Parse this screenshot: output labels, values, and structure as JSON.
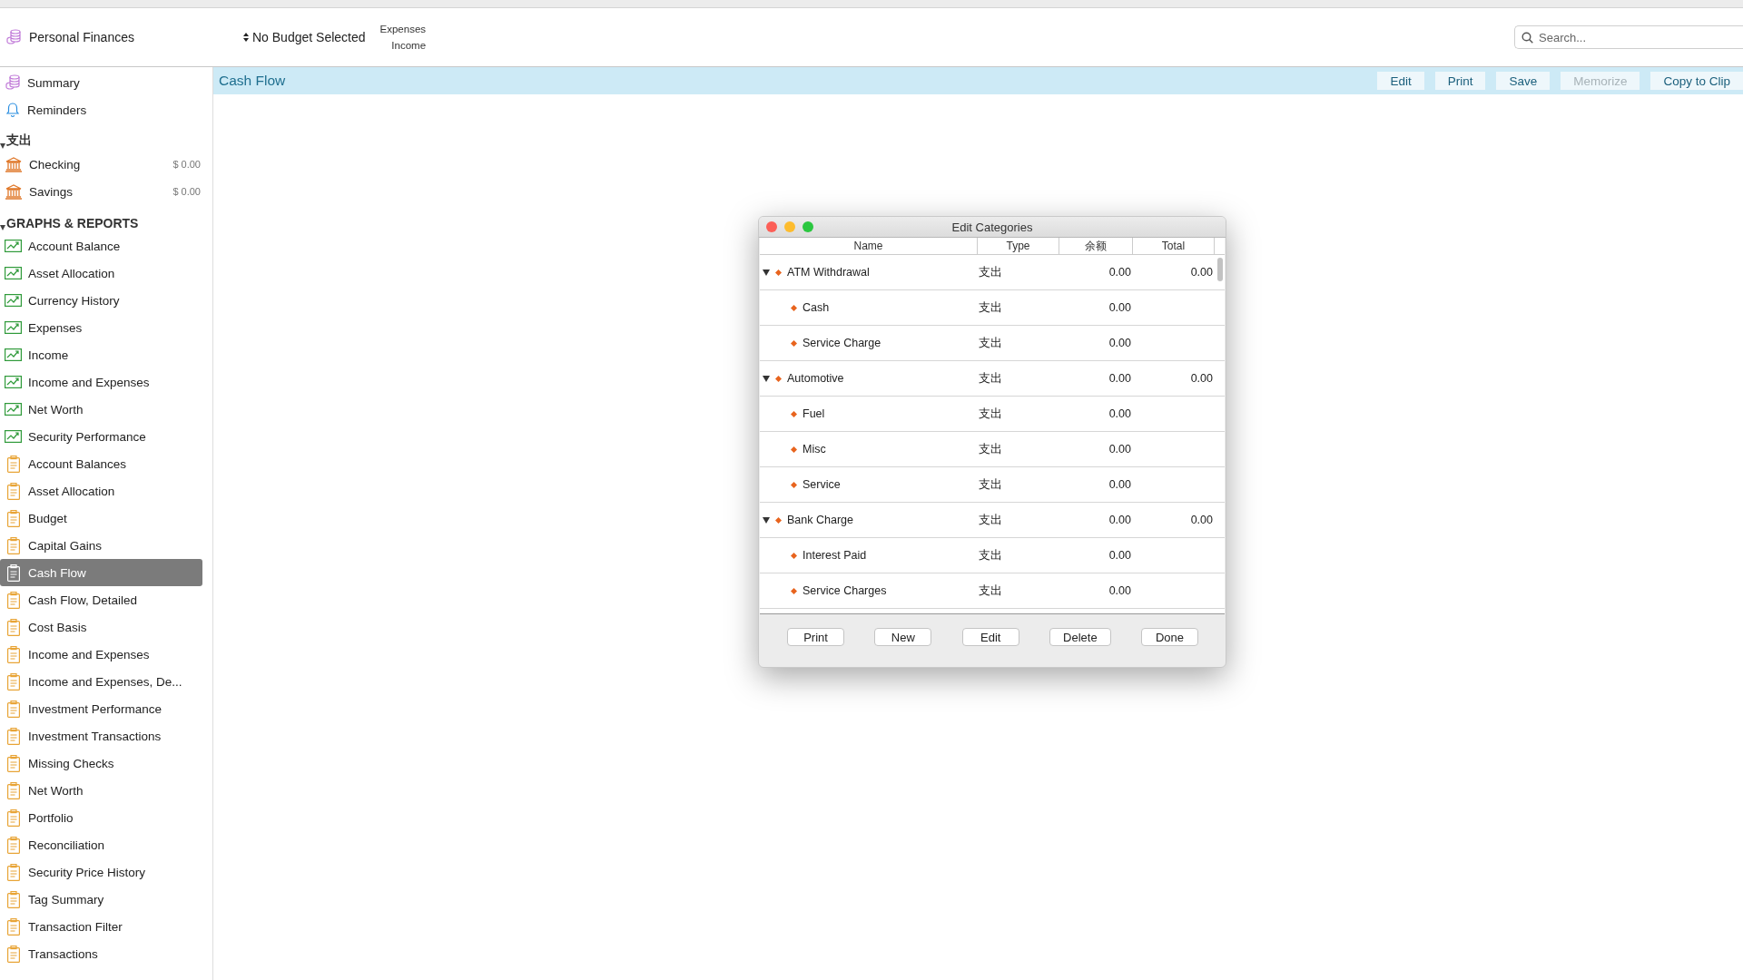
{
  "header": {
    "app_name": "Personal Finances",
    "budget_selector": "No Budget Selected",
    "mode_options": [
      "Expenses",
      "Income"
    ],
    "search": {
      "placeholder": "Search..."
    }
  },
  "sidebar": {
    "top_items": [
      {
        "label": "Summary",
        "kind": "summary",
        "selected": false
      },
      {
        "label": "Reminders",
        "kind": "reminders",
        "selected": false
      }
    ],
    "sections": [
      {
        "title": "支出",
        "expanded": true,
        "items": [
          {
            "label": "Checking",
            "amount": "$ 0.00",
            "kind": "bank",
            "selected": false
          },
          {
            "label": "Savings",
            "amount": "$ 0.00",
            "kind": "bank",
            "selected": false
          }
        ]
      },
      {
        "title": "GRAPHS & REPORTS",
        "expanded": true,
        "items": [
          {
            "label": "Account Balance",
            "kind": "graph",
            "selected": false
          },
          {
            "label": "Asset Allocation",
            "kind": "graph",
            "selected": false
          },
          {
            "label": "Currency History",
            "kind": "graph",
            "selected": false
          },
          {
            "label": "Expenses",
            "kind": "graph",
            "selected": false
          },
          {
            "label": "Income",
            "kind": "graph",
            "selected": false
          },
          {
            "label": "Income and Expenses",
            "kind": "graph",
            "selected": false
          },
          {
            "label": "Net Worth",
            "kind": "graph",
            "selected": false
          },
          {
            "label": "Security Performance",
            "kind": "graph",
            "selected": false
          },
          {
            "label": "Account Balances",
            "kind": "report",
            "selected": false
          },
          {
            "label": "Asset Allocation",
            "kind": "report",
            "selected": false
          },
          {
            "label": "Budget",
            "kind": "report",
            "selected": false
          },
          {
            "label": "Capital Gains",
            "kind": "report",
            "selected": false
          },
          {
            "label": "Cash Flow",
            "kind": "report",
            "selected": true
          },
          {
            "label": "Cash Flow, Detailed",
            "kind": "report",
            "selected": false
          },
          {
            "label": "Cost Basis",
            "kind": "report",
            "selected": false
          },
          {
            "label": "Income and Expenses",
            "kind": "report",
            "selected": false
          },
          {
            "label": "Income and Expenses, De...",
            "kind": "report",
            "selected": false
          },
          {
            "label": "Investment Performance",
            "kind": "report",
            "selected": false
          },
          {
            "label": "Investment Transactions",
            "kind": "report",
            "selected": false
          },
          {
            "label": "Missing Checks",
            "kind": "report",
            "selected": false
          },
          {
            "label": "Net Worth",
            "kind": "report",
            "selected": false
          },
          {
            "label": "Portfolio",
            "kind": "report",
            "selected": false
          },
          {
            "label": "Reconciliation",
            "kind": "report",
            "selected": false
          },
          {
            "label": "Security Price History",
            "kind": "report",
            "selected": false
          },
          {
            "label": "Tag Summary",
            "kind": "report",
            "selected": false
          },
          {
            "label": "Transaction Filter",
            "kind": "report",
            "selected": false
          },
          {
            "label": "Transactions",
            "kind": "report",
            "selected": false
          }
        ]
      }
    ]
  },
  "content": {
    "title": "Cash Flow",
    "toolbar": [
      {
        "label": "Edit",
        "disabled": false
      },
      {
        "label": "Print",
        "disabled": false
      },
      {
        "label": "Save",
        "disabled": false
      },
      {
        "label": "Memorize",
        "disabled": true
      },
      {
        "label": "Copy to Clip",
        "disabled": false
      }
    ]
  },
  "dialog": {
    "title": "Edit Categories",
    "columns": [
      "Name",
      "Type",
      "余额",
      "Total"
    ],
    "rows": [
      {
        "name": "ATM Withdrawal",
        "type": "支出",
        "balance": "0.00",
        "total": "0.00",
        "expanded": true,
        "children": [
          {
            "name": "Cash",
            "type": "支出",
            "balance": "0.00"
          },
          {
            "name": "Service Charge",
            "type": "支出",
            "balance": "0.00"
          }
        ]
      },
      {
        "name": "Automotive",
        "type": "支出",
        "balance": "0.00",
        "total": "0.00",
        "expanded": true,
        "children": [
          {
            "name": "Fuel",
            "type": "支出",
            "balance": "0.00"
          },
          {
            "name": "Misc",
            "type": "支出",
            "balance": "0.00"
          },
          {
            "name": "Service",
            "type": "支出",
            "balance": "0.00"
          }
        ]
      },
      {
        "name": "Bank Charge",
        "type": "支出",
        "balance": "0.00",
        "total": "0.00",
        "expanded": true,
        "children": [
          {
            "name": "Interest Paid",
            "type": "支出",
            "balance": "0.00"
          },
          {
            "name": "Service Charges",
            "type": "支出",
            "balance": "0.00"
          }
        ]
      }
    ],
    "buttons": [
      "Print",
      "New",
      "Edit",
      "Delete",
      "Done"
    ]
  }
}
